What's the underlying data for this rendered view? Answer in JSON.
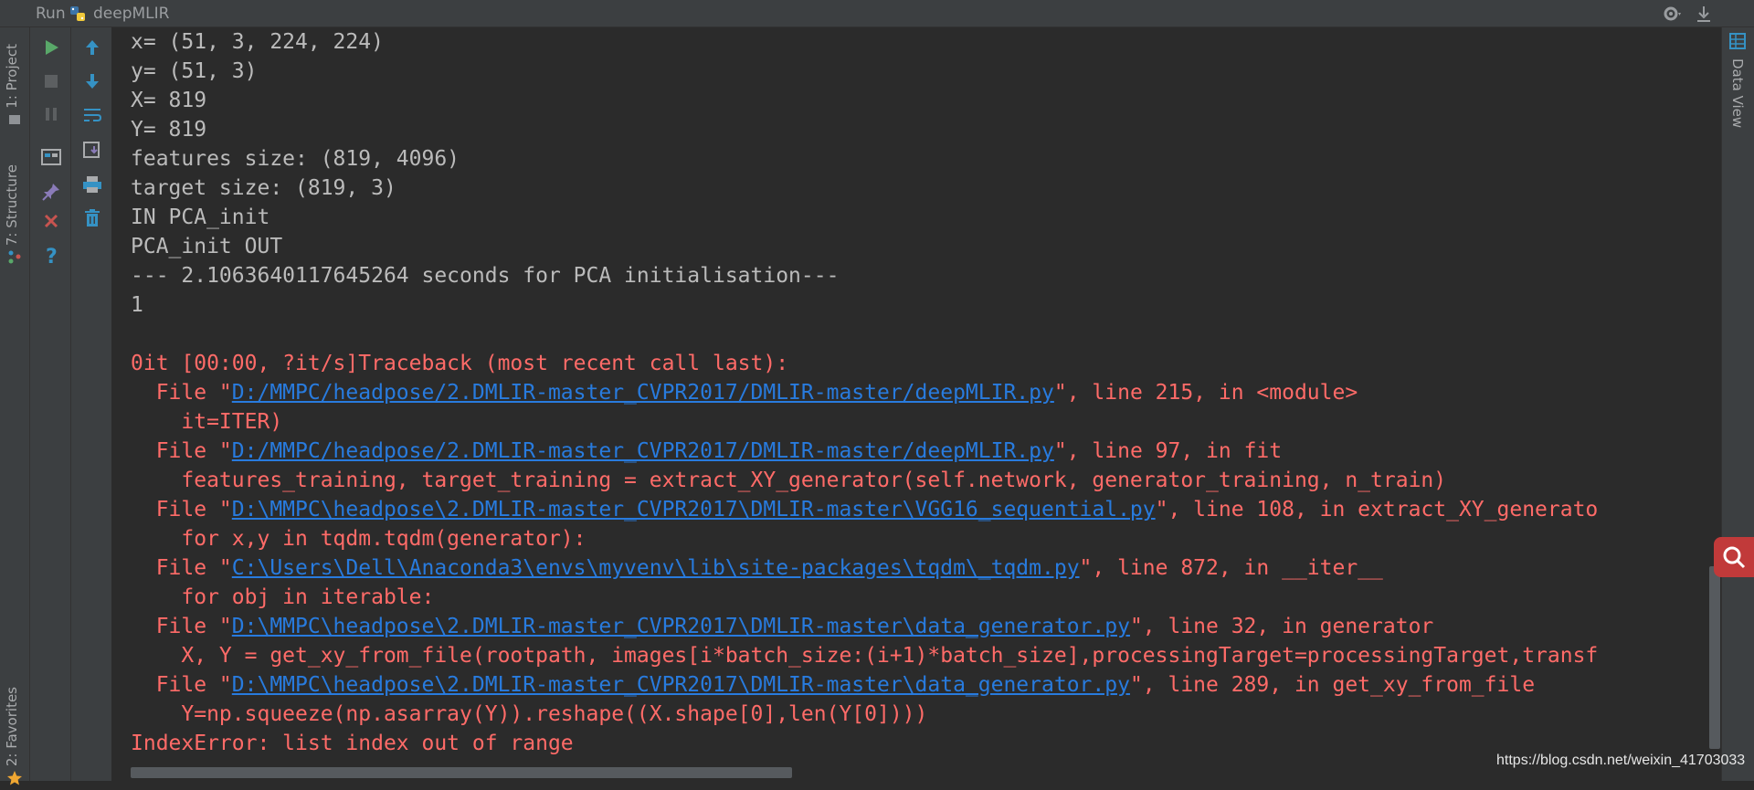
{
  "titlebar": {
    "run_label": "Run",
    "config_name": "deepMLIR",
    "icons": [
      "python-icon",
      "gear-icon",
      "pin-icon"
    ]
  },
  "left_stripe": {
    "tabs": [
      {
        "label": "1: Project",
        "icon": "project-icon"
      },
      {
        "label": "7: Structure",
        "icon": "structure-icon"
      },
      {
        "label": "2: Favorites",
        "icon": "star-icon"
      }
    ]
  },
  "toolbar": {
    "column_a": [
      "run-icon",
      "stop-icon",
      "pause-icon",
      "layout-icon",
      "pin-icon",
      "close-icon",
      "help-icon"
    ],
    "column_b": [
      "up-arrow-icon",
      "down-arrow-icon",
      "soft-wrap-icon",
      "scroll-to-end-icon",
      "print-icon",
      "trash-icon"
    ]
  },
  "right_stripe": {
    "tab_label": "Data View",
    "icon": "table-icon"
  },
  "console": {
    "lines": [
      {
        "type": "out",
        "text": "x= (51, 3, 224, 224)"
      },
      {
        "type": "out",
        "text": "y= (51, 3)"
      },
      {
        "type": "out",
        "text": "X= 819"
      },
      {
        "type": "out",
        "text": "Y= 819"
      },
      {
        "type": "out",
        "text": "features size: (819, 4096)"
      },
      {
        "type": "out",
        "text": "target size: (819, 3)"
      },
      {
        "type": "out",
        "text": "IN PCA_init"
      },
      {
        "type": "out",
        "text": "PCA_init OUT"
      },
      {
        "type": "out",
        "text": "--- 2.1063640117645264 seconds for PCA initialisation---"
      },
      {
        "type": "out",
        "text": "1"
      },
      {
        "type": "out",
        "text": ""
      },
      {
        "type": "err",
        "text": "0it [00:00, ?it/s]Traceback (most recent call last):"
      },
      {
        "type": "file",
        "prefix": "  File \"",
        "link": "D:/MMPC/headpose/2.DMLIR-master_CVPR2017/DMLIR-master/deepMLIR.py",
        "suffix": "\", line 215, in <module>"
      },
      {
        "type": "err",
        "text": "    it=ITER)"
      },
      {
        "type": "file",
        "prefix": "  File \"",
        "link": "D:/MMPC/headpose/2.DMLIR-master_CVPR2017/DMLIR-master/deepMLIR.py",
        "suffix": "\", line 97, in fit"
      },
      {
        "type": "err",
        "text": "    features_training, target_training = extract_XY_generator(self.network, generator_training, n_train)"
      },
      {
        "type": "file",
        "prefix": "  File \"",
        "link": "D:\\MMPC\\headpose\\2.DMLIR-master_CVPR2017\\DMLIR-master\\VGG16_sequential.py",
        "suffix": "\", line 108, in extract_XY_generato"
      },
      {
        "type": "err",
        "text": "    for x,y in tqdm.tqdm(generator):"
      },
      {
        "type": "file",
        "prefix": "  File \"",
        "link": "C:\\Users\\Dell\\Anaconda3\\envs\\myvenv\\lib\\site-packages\\tqdm\\_tqdm.py",
        "suffix": "\", line 872, in __iter__"
      },
      {
        "type": "err",
        "text": "    for obj in iterable:"
      },
      {
        "type": "file",
        "prefix": "  File \"",
        "link": "D:\\MMPC\\headpose\\2.DMLIR-master_CVPR2017\\DMLIR-master\\data_generator.py",
        "suffix": "\", line 32, in generator"
      },
      {
        "type": "err",
        "text": "    X, Y = get_xy_from_file(rootpath, images[i*batch_size:(i+1)*batch_size],processingTarget=processingTarget,transf"
      },
      {
        "type": "file",
        "prefix": "  File \"",
        "link": "D:\\MMPC\\headpose\\2.DMLIR-master_CVPR2017\\DMLIR-master\\data_generator.py",
        "suffix": "\", line 289, in get_xy_from_file"
      },
      {
        "type": "err",
        "text": "    Y=np.squeeze(np.asarray(Y)).reshape((X.shape[0],len(Y[0])))"
      },
      {
        "type": "err",
        "text": "IndexError: list index out of range"
      }
    ]
  },
  "watermark": "https://blog.csdn.net/weixin_41703033",
  "colors": {
    "background": "#2b2b2b",
    "panel": "#3c3f41",
    "stdout": "#bbbbbb",
    "stderr": "#ff6b68",
    "link": "#287bde",
    "run_green": "#59a869",
    "action_blue": "#3592c4",
    "close_red": "#c75450",
    "search_button": "#c13a3a"
  }
}
